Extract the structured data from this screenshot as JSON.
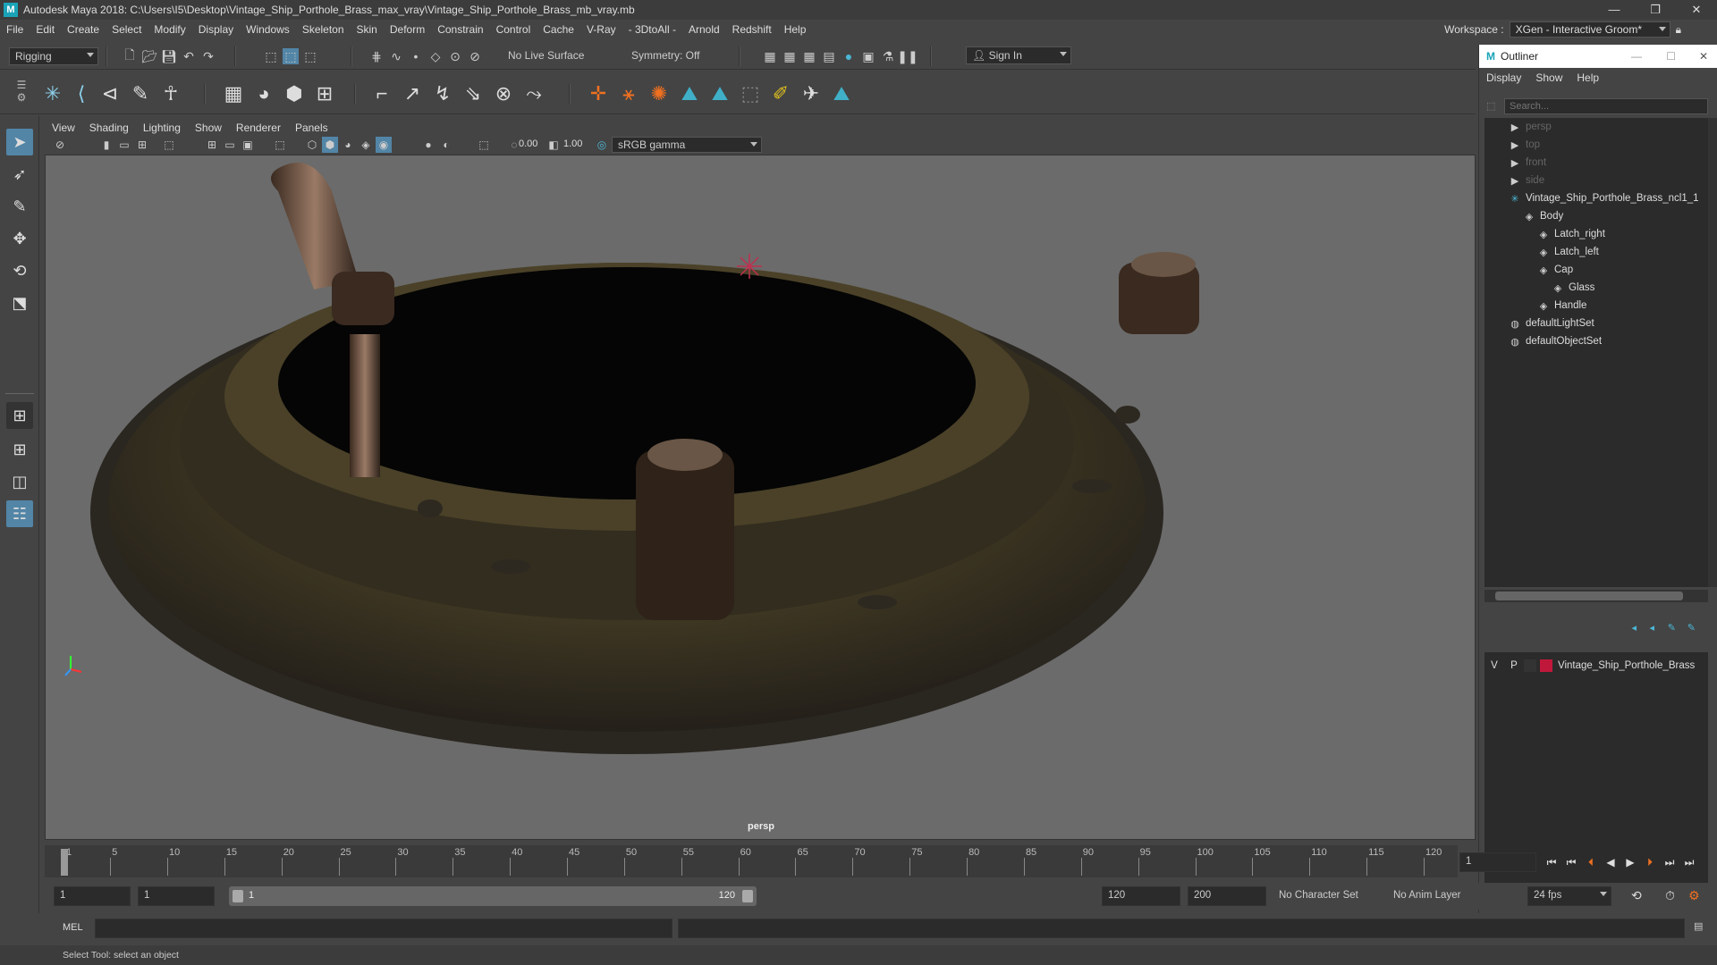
{
  "window": {
    "title": "Autodesk Maya 2018: C:\\Users\\I5\\Desktop\\Vintage_Ship_Porthole_Brass_max_vray\\Vintage_Ship_Porthole_Brass_mb_vray.mb",
    "controls": [
      "—",
      "❐",
      "✕"
    ]
  },
  "menu": [
    "File",
    "Edit",
    "Create",
    "Select",
    "Modify",
    "Display",
    "Windows",
    "Skeleton",
    "Skin",
    "Deform",
    "Constrain",
    "Control",
    "Cache",
    "V-Ray",
    "- 3DtoAll -",
    "Arnold",
    "Redshift",
    "Help"
  ],
  "workspace": {
    "label": "Workspace :",
    "value": "XGen - Interactive Groom*"
  },
  "statusline": {
    "mode": "Rigging",
    "live_surface": "No Live Surface",
    "symmetry": "Symmetry: Off",
    "sign_in": "Sign In"
  },
  "panel_menu": [
    "View",
    "Shading",
    "Lighting",
    "Show",
    "Renderer",
    "Panels"
  ],
  "panel_toolbar": {
    "exposure": "0.00",
    "gamma": "1.00",
    "colorspace": "sRGB gamma"
  },
  "viewport": {
    "camera": "persp"
  },
  "outliner": {
    "title": "Outliner",
    "menu": [
      "Display",
      "Show",
      "Help"
    ],
    "search_placeholder": "Search...",
    "items": [
      {
        "label": "persp",
        "icon": "camera-icon",
        "dim": true,
        "indent": 0
      },
      {
        "label": "top",
        "icon": "camera-icon",
        "dim": true,
        "indent": 0
      },
      {
        "label": "front",
        "icon": "camera-icon",
        "dim": true,
        "indent": 0
      },
      {
        "label": "side",
        "icon": "camera-icon",
        "dim": true,
        "indent": 0
      },
      {
        "label": "Vintage_Ship_Porthole_Brass_ncl1_1",
        "icon": "group-icon",
        "dim": false,
        "indent": 0
      },
      {
        "label": "Body",
        "icon": "mesh-icon",
        "dim": false,
        "indent": 1
      },
      {
        "label": "Latch_right",
        "icon": "mesh-icon",
        "dim": false,
        "indent": 2
      },
      {
        "label": "Latch_left",
        "icon": "mesh-icon",
        "dim": false,
        "indent": 2
      },
      {
        "label": "Cap",
        "icon": "mesh-icon",
        "dim": false,
        "indent": 2
      },
      {
        "label": "Glass",
        "icon": "mesh-icon",
        "dim": false,
        "indent": 3
      },
      {
        "label": "Handle",
        "icon": "mesh-icon",
        "dim": false,
        "indent": 2
      },
      {
        "label": "defaultLightSet",
        "icon": "set-icon",
        "dim": false,
        "indent": 0
      },
      {
        "label": "defaultObjectSet",
        "icon": "set-icon",
        "dim": false,
        "indent": 0
      }
    ]
  },
  "layers": {
    "v": "V",
    "p": "P",
    "name": "Vintage_Ship_Porthole_Brass",
    "color": "#c0183a"
  },
  "timeline": {
    "ticks": [
      "1",
      "5",
      "10",
      "15",
      "20",
      "25",
      "30",
      "35",
      "40",
      "45",
      "50",
      "55",
      "60",
      "65",
      "70",
      "75",
      "80",
      "85",
      "90",
      "95",
      "100",
      "105",
      "110",
      "115",
      "120"
    ],
    "current_frame": "1"
  },
  "range": {
    "start": "1",
    "playback_start": "1",
    "slider_start": "1",
    "slider_end": "120",
    "playback_end": "120",
    "end": "200",
    "character_set": "No Character Set",
    "anim_layer": "No Anim Layer",
    "fps": "24 fps"
  },
  "cmdline": {
    "label": "MEL"
  },
  "helpline": "Select Tool: select an object"
}
